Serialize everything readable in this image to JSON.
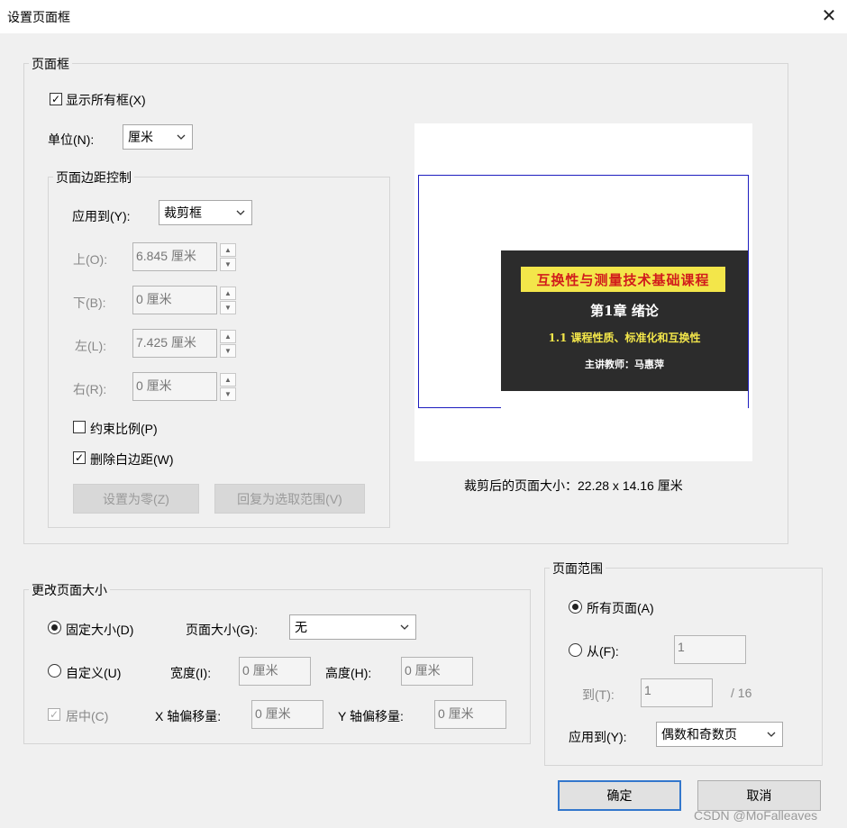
{
  "window": {
    "title": "设置页面框"
  },
  "page_box": {
    "legend": "页面框",
    "show_all_boxes": {
      "label": "显示所有框(X)",
      "checked": true
    },
    "unit": {
      "label": "单位(N):",
      "value": "厘米"
    },
    "margin_control": {
      "legend": "页面边距控制",
      "apply_to": {
        "label": "应用到(Y):",
        "value": "裁剪框"
      },
      "top": {
        "label": "上(O):",
        "value": "6.845 厘米"
      },
      "bottom": {
        "label": "下(B):",
        "value": "0 厘米"
      },
      "left": {
        "label": "左(L):",
        "value": "7.425 厘米"
      },
      "right": {
        "label": "右(R):",
        "value": "0 厘米"
      },
      "constrain_proportions": {
        "label": "约束比例(P)",
        "checked": false
      },
      "remove_white_margins": {
        "label": "删除白边距(W)",
        "checked": true
      },
      "set_to_zero_label": "设置为零(Z)",
      "revert_to_selection_label": "回复为选取范围(V)"
    },
    "preview": {
      "slide_title": "互换性与测量技术基础课程",
      "slide_chapter": "第1章 绪论",
      "slide_section": "1.1 课程性质、标准化和互换性",
      "slide_teacher": "主讲教师：马惠萍"
    },
    "cropped_size": "裁剪后的页面大小：22.28 x 14.16 厘米"
  },
  "change_page_size": {
    "legend": "更改页面大小",
    "fixed_size": {
      "label": "固定大小(D)",
      "selected": true
    },
    "page_size": {
      "label": "页面大小(G):",
      "value": "无"
    },
    "custom": {
      "label": "自定义(U)",
      "selected": false
    },
    "width": {
      "label": "宽度(I):",
      "value": "0 厘米"
    },
    "height": {
      "label": "高度(H):",
      "value": "0 厘米"
    },
    "center": {
      "label": "居中(C)",
      "checked": true
    },
    "x_offset": {
      "label": "X 轴偏移量:",
      "value": "0 厘米"
    },
    "y_offset": {
      "label": "Y 轴偏移量:",
      "value": "0 厘米"
    }
  },
  "page_range": {
    "legend": "页面范围",
    "all_pages": {
      "label": "所有页面(A)",
      "selected": true
    },
    "from": {
      "label": "从(F):",
      "value": "1",
      "selected": false
    },
    "to": {
      "label": "到(T):",
      "value": "1"
    },
    "total": "/ 16",
    "apply_to": {
      "label": "应用到(Y):",
      "value": "偶数和奇数页"
    }
  },
  "buttons": {
    "ok_label": "确定",
    "cancel_label": "取消"
  },
  "watermark": "CSDN @MoFalleaves"
}
